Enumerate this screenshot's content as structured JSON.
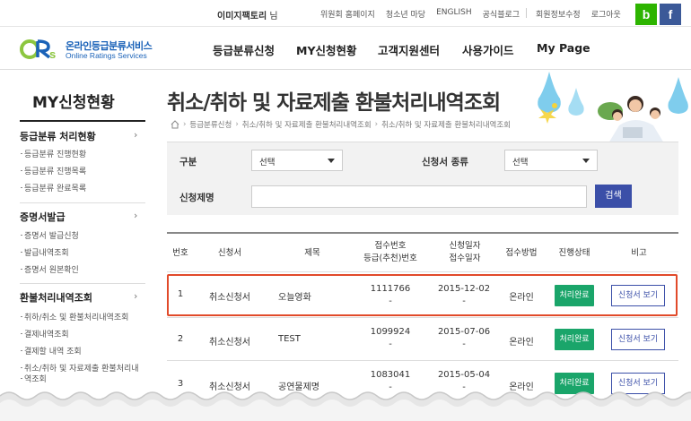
{
  "topbar": {
    "user_name": "이미지팩토리",
    "user_suffix": "님",
    "links": [
      "위원회 홈페이지",
      "청소년 마당",
      "ENGLISH",
      "공식블로그"
    ],
    "account_links": [
      "회원정보수정",
      "로그아웃"
    ],
    "blog_icon": "b",
    "facebook_icon": "f"
  },
  "logo": {
    "korean": "온라인등급분류서비스",
    "english": "Online Ratings Services"
  },
  "gnb": [
    "등급분류신청",
    "MY신청현황",
    "고객지원센터",
    "사용가이드",
    "My Page"
  ],
  "sidebar": {
    "title": "MY신청현황",
    "sections": [
      {
        "label": "등급분류 처리현황",
        "items": [
          "등급분류 진행현황",
          "등급분류 진행목록",
          "등급분류 완료목록"
        ]
      },
      {
        "label": "증명서발급",
        "items": [
          "증명서 발급신청",
          "발급내역조회",
          "증명서 원본확인"
        ]
      },
      {
        "label": "환불처리내역조회",
        "items": [
          "취하/취소 및 환불처리내역조회",
          "결제내역조회",
          "결제할 내역 조회",
          "취소/취하 및 자료제출 환불처리내",
          "역조회"
        ]
      }
    ]
  },
  "page": {
    "title": "취소/취하 및 자료제출 환불처리내역조회",
    "breadcrumb": [
      "등급분류신청",
      "취소/취하 및 자료제출 환불처리내역조회",
      "취소/취하 및 자료제출 환불처리내역조회"
    ]
  },
  "search": {
    "type_label": "구분",
    "type_value": "선택",
    "form_label": "신청서 종류",
    "form_value": "선택",
    "name_label": "신청제명",
    "name_value": "",
    "button_label": "검색"
  },
  "table": {
    "headers": {
      "no": "번호",
      "form": "신청서",
      "title": "제목",
      "receipt_1": "접수번호",
      "receipt_2": "등급(추천)번호",
      "date_1": "신청일자",
      "date_2": "접수일자",
      "method": "접수방법",
      "status": "진행상태",
      "note": "비고"
    },
    "rows": [
      {
        "no": "1",
        "form": "취소신청서",
        "title": "오늘영화",
        "receipt": "1111766",
        "rating": "-",
        "apply_date": "2015-12-02",
        "receipt_date": "-",
        "method": "온라인",
        "status": "처리완료",
        "action": "신청서 보기"
      },
      {
        "no": "2",
        "form": "취소신청서",
        "title": "TEST",
        "receipt": "1099924",
        "rating": "-",
        "apply_date": "2015-07-06",
        "receipt_date": "-",
        "method": "온라인",
        "status": "처리완료",
        "action": "신청서 보기"
      },
      {
        "no": "3",
        "form": "취소신청서",
        "title": "공연물제명",
        "receipt": "1083041",
        "rating": "-",
        "apply_date": "2015-05-04",
        "receipt_date": "-",
        "method": "온라인",
        "status": "처리완료",
        "action": "신청서 보기"
      }
    ]
  },
  "colors": {
    "accent_blue": "#3b4fa8",
    "status_green": "#1aa56a",
    "highlight_red": "#e14a2a",
    "logo_blue": "#1a62b8",
    "logo_green": "#8cc63f"
  }
}
